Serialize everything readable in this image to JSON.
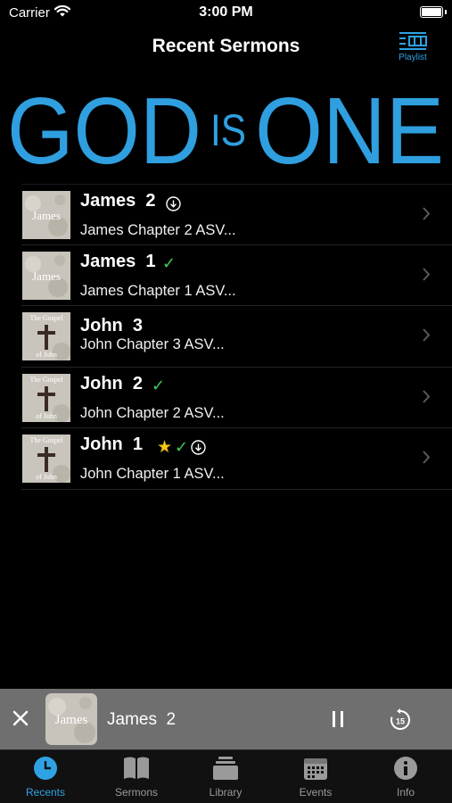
{
  "status_bar": {
    "carrier": "Carrier",
    "time": "3:00 PM"
  },
  "nav": {
    "title": "Recent Sermons",
    "playlist_label": "Playlist"
  },
  "banner": {
    "word1": "GOD",
    "word2": "IS",
    "word3": "ONE",
    "color": "#2f9fdf"
  },
  "sermons": [
    {
      "title": "James  2",
      "subtitle": "James Chapter 2 ASV...",
      "art_text": "James",
      "art": "james",
      "badges": [
        "download-icon"
      ]
    },
    {
      "title": "James  1",
      "subtitle": "James Chapter 1 ASV...",
      "art_text": "James",
      "art": "james",
      "badges": [
        "check-icon"
      ]
    },
    {
      "title": "John  3",
      "subtitle": "John Chapter 3 ASV...",
      "art_text_top": "The Gospel",
      "art_text_bottom": "of John",
      "art": "john",
      "badges": []
    },
    {
      "title": "John  2",
      "subtitle": "John Chapter 2 ASV...",
      "art_text_top": "The Gospel",
      "art_text_bottom": "of John",
      "art": "john",
      "badges": [
        "check-icon"
      ]
    },
    {
      "title": "John  1",
      "subtitle": "John Chapter 1 ASV...",
      "art_text_top": "The Gospel",
      "art_text_bottom": "of John",
      "art": "john",
      "badges": [
        "star-icon",
        "check-icon",
        "download-icon"
      ]
    }
  ],
  "player": {
    "title": "James  2",
    "art_text": "James",
    "state": "playing",
    "skip_back_seconds": "15"
  },
  "tabs": [
    {
      "label": "Recents",
      "icon": "clock-icon",
      "active": true
    },
    {
      "label": "Sermons",
      "icon": "book-icon",
      "active": false
    },
    {
      "label": "Library",
      "icon": "library-icon",
      "active": false
    },
    {
      "label": "Events",
      "icon": "calendar-icon",
      "active": false
    },
    {
      "label": "Info",
      "icon": "info-icon",
      "active": false
    }
  ],
  "colors": {
    "accent": "#2fa2e3",
    "check": "#3ecb5b",
    "star": "#f5c518",
    "player_bg": "#6f6f6f"
  }
}
